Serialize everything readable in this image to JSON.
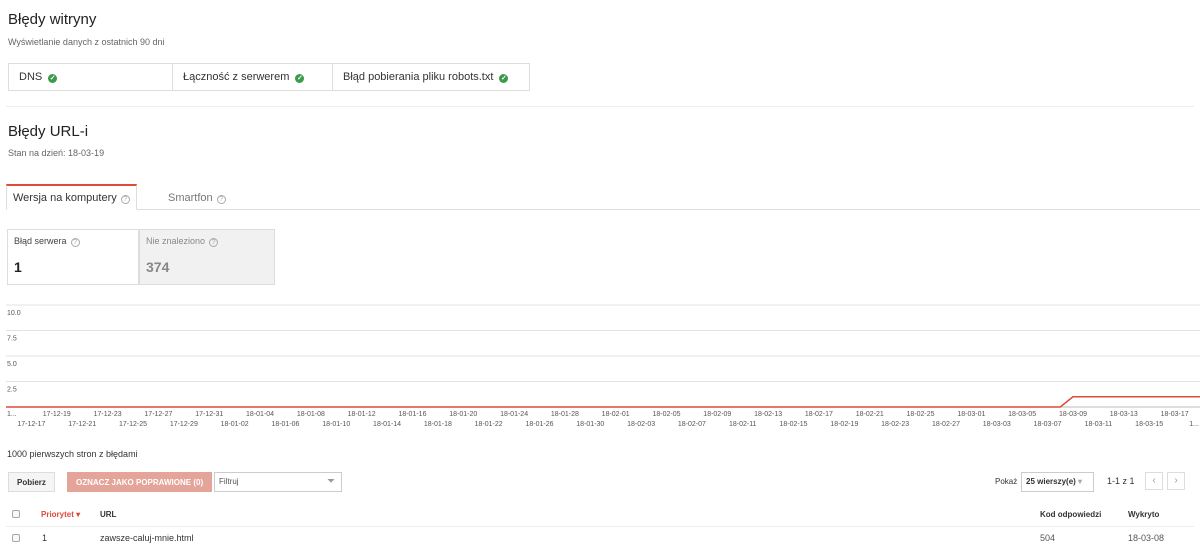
{
  "site_errors": {
    "title": "Błędy witryny",
    "subtitle": "Wyświetlanie danych z ostatnich 90 dni",
    "items": [
      {
        "label": "DNS"
      },
      {
        "label": "Łączność z serwerem"
      },
      {
        "label": "Błąd pobierania pliku robots.txt"
      }
    ]
  },
  "url_errors": {
    "title": "Błędy URL-i",
    "subtitle": "Stan na dzień: 18-03-19"
  },
  "tabs": [
    {
      "label": "Wersja na komputery"
    },
    {
      "label": "Smartfon"
    }
  ],
  "metrics": [
    {
      "label": "Błąd serwera",
      "value": "1"
    },
    {
      "label": "Nie znaleziono",
      "value": "374"
    }
  ],
  "chart_data": {
    "type": "line",
    "y_ticks": [
      "10.0",
      "7.5",
      "5.0",
      "2.5"
    ],
    "ylim": [
      0,
      10
    ],
    "x_ticks_top": [
      "1...",
      "17-12-19",
      "17-12-23",
      "17-12-27",
      "17-12-31",
      "18-01-04",
      "18-01-08",
      "18-01-12",
      "18-01-16",
      "18-01-20",
      "18-01-24",
      "18-01-28",
      "18-02-01",
      "18-02-05",
      "18-02-09",
      "18-02-13",
      "18-02-17",
      "18-02-21",
      "18-02-25",
      "18-03-01",
      "18-03-05",
      "18-03-09",
      "18-03-13",
      "18-03-17"
    ],
    "x_ticks_bottom": [
      "17-12-17",
      "17-12-21",
      "17-12-25",
      "17-12-29",
      "18-01-02",
      "18-01-06",
      "18-01-10",
      "18-01-14",
      "18-01-18",
      "18-01-22",
      "18-01-26",
      "18-01-30",
      "18-02-03",
      "18-02-07",
      "18-02-11",
      "18-02-15",
      "18-02-19",
      "18-02-23",
      "18-02-27",
      "18-03-03",
      "18-03-07",
      "18-03-11",
      "18-03-15",
      "1..."
    ],
    "series": [
      {
        "color": "#dd4b39",
        "x": [
          "17-12-15",
          "18-03-08",
          "18-03-09",
          "18-03-19"
        ],
        "values": [
          0,
          0,
          1,
          1
        ]
      }
    ]
  },
  "table": {
    "title": "1000 pierwszych stron z błędami",
    "download_label": "Pobierz",
    "mark_fixed_label": "OZNACZ JAKO POPRAWIONE (0)",
    "filter_placeholder": "Filtruj",
    "show_label": "Pokaż",
    "rows_select": "25 wierszy(e)",
    "pagination": "1-1 z 1",
    "columns": {
      "priority": "Priorytet",
      "url": "URL",
      "code": "Kod odpowiedzi",
      "detected": "Wykryto"
    },
    "rows": [
      {
        "priority": "1",
        "url": "zawsze-caluj-mnie.html",
        "code": "504",
        "detected": "18-03-08"
      }
    ]
  },
  "colors": {
    "accent": "#dd4b39",
    "ok": "#3c9a4b"
  }
}
